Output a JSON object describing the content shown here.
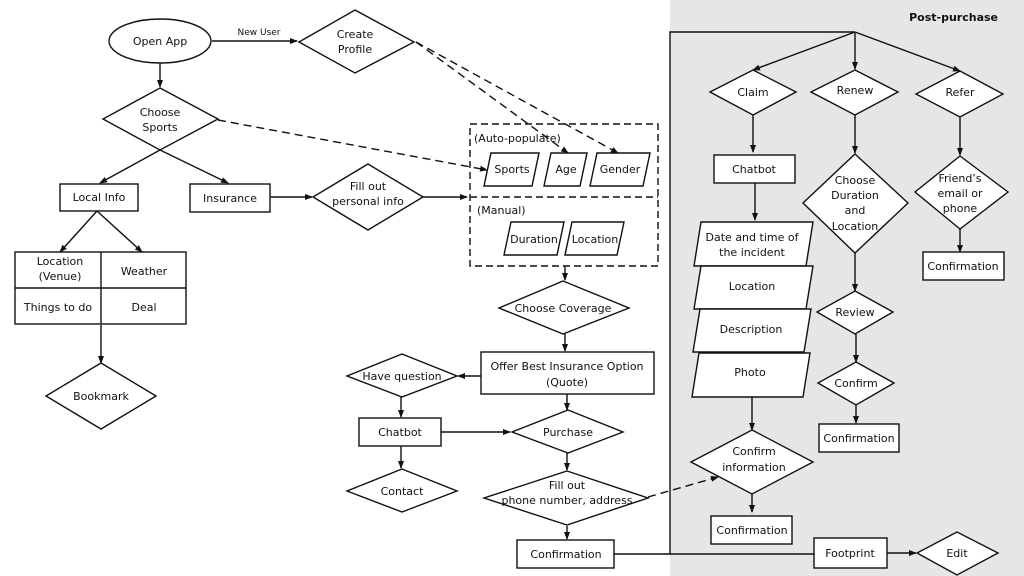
{
  "panel": {
    "title": "Post-purchase",
    "background": "#e6e6e6"
  },
  "edge_labels": {
    "new_user": "New User"
  },
  "nodes": {
    "open_app": "Open App",
    "create_profile": [
      "Create",
      "Profile"
    ],
    "choose_sports": [
      "Choose",
      "Sports"
    ],
    "local_info": "Local Info",
    "insurance": "Insurance",
    "fill_personal": [
      "Fill out",
      "personal info"
    ],
    "auto_label": "(Auto-populate)",
    "manual_label": "(Manual)",
    "sports": "Sports",
    "age": "Age",
    "gender": "Gender",
    "duration": "Duration",
    "location": "Location",
    "grid": {
      "location_venue": [
        "Location",
        "(Venue)"
      ],
      "weather": "Weather",
      "things_to_do": "Things to do",
      "deal": "Deal"
    },
    "bookmark": "Bookmark",
    "choose_coverage": "Choose Coverage",
    "offer": [
      "Offer Best Insurance Option",
      "(Quote)"
    ],
    "have_question": "Have question",
    "chatbot": "Chatbot",
    "contact": "Contact",
    "purchase": "Purchase",
    "fill_phone": [
      "Fill out",
      "phone number, address"
    ],
    "confirmation": "Confirmation",
    "claim": "Claim",
    "renew": "Renew",
    "refer": "Refer",
    "claim_chatbot": "Chatbot",
    "date_time": [
      "Date and time of",
      "the incident"
    ],
    "claim_location": "Location",
    "description": "Description",
    "photo": "Photo",
    "confirm_info": [
      "Confirm",
      "information"
    ],
    "claim_confirmation": "Confirmation",
    "choose_dur_loc": [
      "Choose",
      "Duration",
      "and",
      "Location"
    ],
    "review": "Review",
    "confirm": "Confirm",
    "renew_confirmation": "Confirmation",
    "friend_contact": [
      "Friend’s",
      "email or",
      "phone"
    ],
    "refer_confirmation": "Confirmation",
    "footprint": "Footprint",
    "edit": "Edit"
  }
}
